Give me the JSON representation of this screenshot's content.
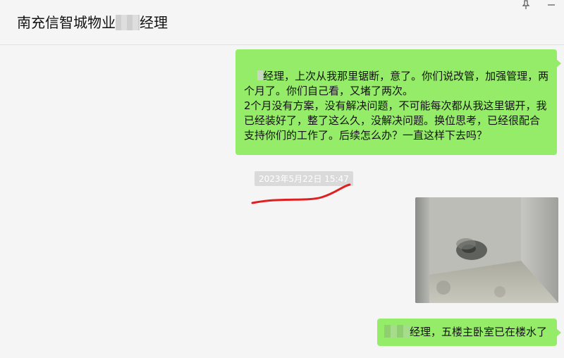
{
  "header": {
    "title_prefix": "南充信智城物业",
    "title_suffix": "经理",
    "pin_icon": "pin-icon",
    "minimize_icon": "minimize-icon"
  },
  "messages": [
    {
      "type": "text",
      "sender": "self",
      "prefix": "经理，上次从我那里锯断，",
      "text": "意了。你们说改管，加强管理，两个月了。你们自己看，又堵了两次。\n2个月没有方案，没有解决问题，不可能每次都从我这里锯开，我已经装好了，整了这么久，没解决问题。换位思考，已经很配合支持你们的工作了。后续怎么办？一直这样下去吗？"
    },
    {
      "type": "timestamp",
      "text": "2023年5月22日 15:47"
    },
    {
      "type": "image",
      "sender": "self",
      "alt": "photo"
    },
    {
      "type": "text",
      "sender": "self",
      "text": "经理，五楼主卧室已在楼水了"
    }
  ],
  "colors": {
    "bubble_self": "#95ec69",
    "background": "#f5f5f5",
    "annotation_red": "#e02020"
  }
}
